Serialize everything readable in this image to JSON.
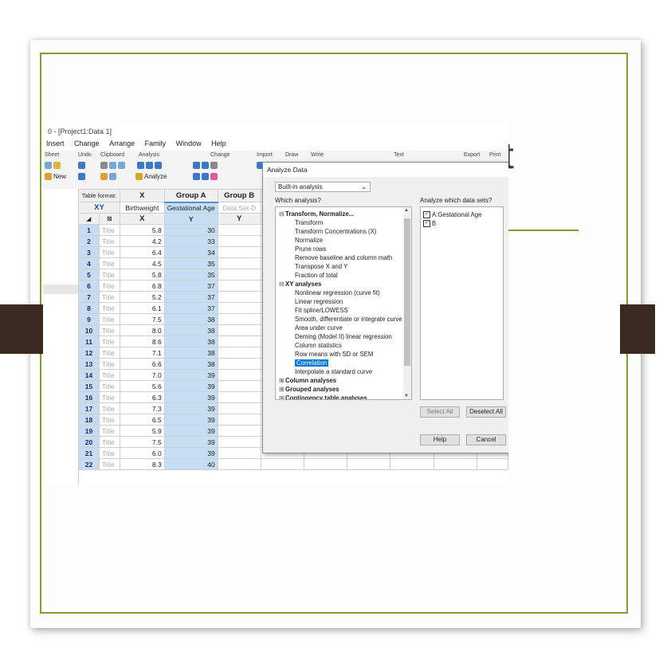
{
  "slide": {
    "title_fragment": "t",
    "accent_color": "#7f9e2e",
    "tab_color": "#3a2a20"
  },
  "window": {
    "title": "0 - [Project1:Data 1]",
    "menus": [
      "Insert",
      "Change",
      "Arrange",
      "Family",
      "Window",
      "Help"
    ]
  },
  "ribbon": {
    "groups": [
      "Sheet",
      "Undo",
      "Clipboard",
      "Analysis",
      "Change",
      "Import",
      "Draw",
      "Write",
      "Text",
      "Export",
      "Print"
    ],
    "new_label": "New",
    "analyze_label": "Analyze"
  },
  "sheet": {
    "table_format_label": "Table format:",
    "table_format_value": "XY",
    "col_x": "X",
    "col_group_a": "Group A",
    "col_group_b": "Group B",
    "x_title": "Birthweight",
    "a_title": "Gestational Age",
    "b_title": "Data Set-D",
    "sub_x": "X",
    "sub_a": "Y",
    "sub_b": "Y",
    "row_label": "Title",
    "rows": [
      {
        "n": "1",
        "x": "5.8",
        "y": "30"
      },
      {
        "n": "2",
        "x": "4.2",
        "y": "33"
      },
      {
        "n": "3",
        "x": "6.4",
        "y": "34"
      },
      {
        "n": "4",
        "x": "4.5",
        "y": "35"
      },
      {
        "n": "5",
        "x": "5.8",
        "y": "35"
      },
      {
        "n": "6",
        "x": "6.8",
        "y": "37"
      },
      {
        "n": "7",
        "x": "5.2",
        "y": "37"
      },
      {
        "n": "8",
        "x": "6.1",
        "y": "37"
      },
      {
        "n": "9",
        "x": "7.5",
        "y": "38"
      },
      {
        "n": "10",
        "x": "8.0",
        "y": "38"
      },
      {
        "n": "11",
        "x": "8.6",
        "y": "38"
      },
      {
        "n": "12",
        "x": "7.1",
        "y": "38"
      },
      {
        "n": "13",
        "x": "6.6",
        "y": "38"
      },
      {
        "n": "14",
        "x": "7.0",
        "y": "39"
      },
      {
        "n": "15",
        "x": "5.6",
        "y": "39"
      },
      {
        "n": "16",
        "x": "6.3",
        "y": "39"
      },
      {
        "n": "17",
        "x": "7.3",
        "y": "39"
      },
      {
        "n": "18",
        "x": "6.5",
        "y": "39"
      },
      {
        "n": "19",
        "x": "5.9",
        "y": "39"
      },
      {
        "n": "20",
        "x": "7.5",
        "y": "39"
      },
      {
        "n": "21",
        "x": "6.0",
        "y": "39"
      },
      {
        "n": "22",
        "x": "8.3",
        "y": "40"
      }
    ]
  },
  "dialog": {
    "title": "Analyze Data",
    "dropdown_value": "Built-in analysis",
    "which_label": "Which analysis?",
    "datasets_label": "Analyze which data sets?",
    "categories": [
      {
        "label": "Transform, Normalize...",
        "expanded": true,
        "items": [
          "Transform",
          "Transform Concentrations (X)",
          "Normalize",
          "Prune rows",
          "Remove baseline and column math",
          "Transpose X and Y",
          "Fraction of total"
        ]
      },
      {
        "label": "XY analyses",
        "expanded": true,
        "items": [
          "Nonlinear regression (curve fit)",
          "Linear regression",
          "Fit spline/LOWESS",
          "Smooth, differentiate or integrate curve",
          "Area under curve",
          "Deming (Model II) linear regression",
          "Column statistics",
          "Row means with SD or SEM",
          "Correlation",
          "Interpolate a standard curve"
        ]
      },
      {
        "label": "Column analyses",
        "expanded": false,
        "items": []
      },
      {
        "label": "Grouped analyses",
        "expanded": false,
        "items": []
      },
      {
        "label": "Contingency table analyses",
        "expanded": false,
        "items": []
      }
    ],
    "selected_item": "Correlation",
    "datasets": [
      "A:Gestational Age",
      "B"
    ],
    "select_all": "Select All",
    "deselect_all": "Deselect All",
    "help": "Help",
    "cancel": "Cancel"
  }
}
